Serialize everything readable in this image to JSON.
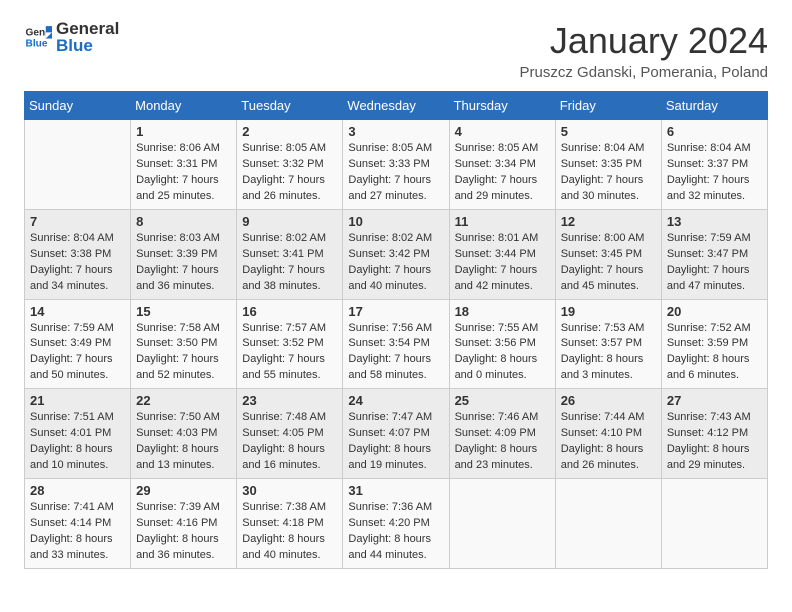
{
  "header": {
    "logo_general": "General",
    "logo_blue": "Blue",
    "title": "January 2024",
    "subtitle": "Pruszcz Gdanski, Pomerania, Poland"
  },
  "columns": [
    "Sunday",
    "Monday",
    "Tuesday",
    "Wednesday",
    "Thursday",
    "Friday",
    "Saturday"
  ],
  "weeks": [
    [
      {
        "day": "",
        "sunrise": "",
        "sunset": "",
        "daylight": ""
      },
      {
        "day": "1",
        "sunrise": "Sunrise: 8:06 AM",
        "sunset": "Sunset: 3:31 PM",
        "daylight": "Daylight: 7 hours and 25 minutes."
      },
      {
        "day": "2",
        "sunrise": "Sunrise: 8:05 AM",
        "sunset": "Sunset: 3:32 PM",
        "daylight": "Daylight: 7 hours and 26 minutes."
      },
      {
        "day": "3",
        "sunrise": "Sunrise: 8:05 AM",
        "sunset": "Sunset: 3:33 PM",
        "daylight": "Daylight: 7 hours and 27 minutes."
      },
      {
        "day": "4",
        "sunrise": "Sunrise: 8:05 AM",
        "sunset": "Sunset: 3:34 PM",
        "daylight": "Daylight: 7 hours and 29 minutes."
      },
      {
        "day": "5",
        "sunrise": "Sunrise: 8:04 AM",
        "sunset": "Sunset: 3:35 PM",
        "daylight": "Daylight: 7 hours and 30 minutes."
      },
      {
        "day": "6",
        "sunrise": "Sunrise: 8:04 AM",
        "sunset": "Sunset: 3:37 PM",
        "daylight": "Daylight: 7 hours and 32 minutes."
      }
    ],
    [
      {
        "day": "7",
        "sunrise": "Sunrise: 8:04 AM",
        "sunset": "Sunset: 3:38 PM",
        "daylight": "Daylight: 7 hours and 34 minutes."
      },
      {
        "day": "8",
        "sunrise": "Sunrise: 8:03 AM",
        "sunset": "Sunset: 3:39 PM",
        "daylight": "Daylight: 7 hours and 36 minutes."
      },
      {
        "day": "9",
        "sunrise": "Sunrise: 8:02 AM",
        "sunset": "Sunset: 3:41 PM",
        "daylight": "Daylight: 7 hours and 38 minutes."
      },
      {
        "day": "10",
        "sunrise": "Sunrise: 8:02 AM",
        "sunset": "Sunset: 3:42 PM",
        "daylight": "Daylight: 7 hours and 40 minutes."
      },
      {
        "day": "11",
        "sunrise": "Sunrise: 8:01 AM",
        "sunset": "Sunset: 3:44 PM",
        "daylight": "Daylight: 7 hours and 42 minutes."
      },
      {
        "day": "12",
        "sunrise": "Sunrise: 8:00 AM",
        "sunset": "Sunset: 3:45 PM",
        "daylight": "Daylight: 7 hours and 45 minutes."
      },
      {
        "day": "13",
        "sunrise": "Sunrise: 7:59 AM",
        "sunset": "Sunset: 3:47 PM",
        "daylight": "Daylight: 7 hours and 47 minutes."
      }
    ],
    [
      {
        "day": "14",
        "sunrise": "Sunrise: 7:59 AM",
        "sunset": "Sunset: 3:49 PM",
        "daylight": "Daylight: 7 hours and 50 minutes."
      },
      {
        "day": "15",
        "sunrise": "Sunrise: 7:58 AM",
        "sunset": "Sunset: 3:50 PM",
        "daylight": "Daylight: 7 hours and 52 minutes."
      },
      {
        "day": "16",
        "sunrise": "Sunrise: 7:57 AM",
        "sunset": "Sunset: 3:52 PM",
        "daylight": "Daylight: 7 hours and 55 minutes."
      },
      {
        "day": "17",
        "sunrise": "Sunrise: 7:56 AM",
        "sunset": "Sunset: 3:54 PM",
        "daylight": "Daylight: 7 hours and 58 minutes."
      },
      {
        "day": "18",
        "sunrise": "Sunrise: 7:55 AM",
        "sunset": "Sunset: 3:56 PM",
        "daylight": "Daylight: 8 hours and 0 minutes."
      },
      {
        "day": "19",
        "sunrise": "Sunrise: 7:53 AM",
        "sunset": "Sunset: 3:57 PM",
        "daylight": "Daylight: 8 hours and 3 minutes."
      },
      {
        "day": "20",
        "sunrise": "Sunrise: 7:52 AM",
        "sunset": "Sunset: 3:59 PM",
        "daylight": "Daylight: 8 hours and 6 minutes."
      }
    ],
    [
      {
        "day": "21",
        "sunrise": "Sunrise: 7:51 AM",
        "sunset": "Sunset: 4:01 PM",
        "daylight": "Daylight: 8 hours and 10 minutes."
      },
      {
        "day": "22",
        "sunrise": "Sunrise: 7:50 AM",
        "sunset": "Sunset: 4:03 PM",
        "daylight": "Daylight: 8 hours and 13 minutes."
      },
      {
        "day": "23",
        "sunrise": "Sunrise: 7:48 AM",
        "sunset": "Sunset: 4:05 PM",
        "daylight": "Daylight: 8 hours and 16 minutes."
      },
      {
        "day": "24",
        "sunrise": "Sunrise: 7:47 AM",
        "sunset": "Sunset: 4:07 PM",
        "daylight": "Daylight: 8 hours and 19 minutes."
      },
      {
        "day": "25",
        "sunrise": "Sunrise: 7:46 AM",
        "sunset": "Sunset: 4:09 PM",
        "daylight": "Daylight: 8 hours and 23 minutes."
      },
      {
        "day": "26",
        "sunrise": "Sunrise: 7:44 AM",
        "sunset": "Sunset: 4:10 PM",
        "daylight": "Daylight: 8 hours and 26 minutes."
      },
      {
        "day": "27",
        "sunrise": "Sunrise: 7:43 AM",
        "sunset": "Sunset: 4:12 PM",
        "daylight": "Daylight: 8 hours and 29 minutes."
      }
    ],
    [
      {
        "day": "28",
        "sunrise": "Sunrise: 7:41 AM",
        "sunset": "Sunset: 4:14 PM",
        "daylight": "Daylight: 8 hours and 33 minutes."
      },
      {
        "day": "29",
        "sunrise": "Sunrise: 7:39 AM",
        "sunset": "Sunset: 4:16 PM",
        "daylight": "Daylight: 8 hours and 36 minutes."
      },
      {
        "day": "30",
        "sunrise": "Sunrise: 7:38 AM",
        "sunset": "Sunset: 4:18 PM",
        "daylight": "Daylight: 8 hours and 40 minutes."
      },
      {
        "day": "31",
        "sunrise": "Sunrise: 7:36 AM",
        "sunset": "Sunset: 4:20 PM",
        "daylight": "Daylight: 8 hours and 44 minutes."
      },
      {
        "day": "",
        "sunrise": "",
        "sunset": "",
        "daylight": ""
      },
      {
        "day": "",
        "sunrise": "",
        "sunset": "",
        "daylight": ""
      },
      {
        "day": "",
        "sunrise": "",
        "sunset": "",
        "daylight": ""
      }
    ]
  ]
}
